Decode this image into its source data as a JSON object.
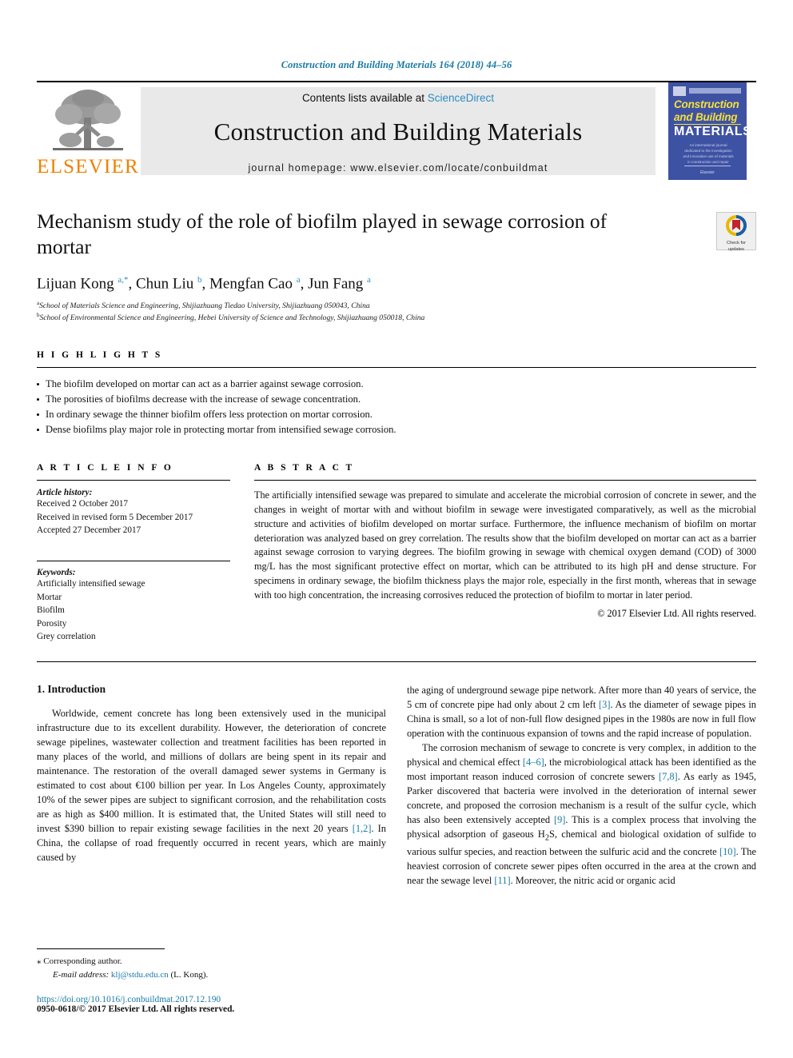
{
  "running_head": "Construction and Building Materials 164 (2018) 44–56",
  "masthead": {
    "publisher_name": "ELSEVIER",
    "contents_prefix": "Contents lists available at ",
    "contents_link": "ScienceDirect",
    "journal_title": "Construction and Building Materials",
    "homepage": "journal homepage: www.elsevier.com/locate/conbuildmat",
    "cover": {
      "line1": "Construction",
      "line2": "and Building",
      "line3": "MATERIALS",
      "blurb": "An international journal dedicated to the investigation and innovative use of materials in construction and repair",
      "footer": "Elsevier"
    }
  },
  "article": {
    "title": "Mechanism study of the role of biofilm played in sewage corrosion of mortar",
    "crossmark_line1": "Check for",
    "crossmark_line2": "updates",
    "authors_html": "Lijuan Kong <sup>a,*</sup>, Chun Liu <sup>b</sup>, Mengfan Cao <sup>a</sup>, Jun Fang <sup>a</sup>",
    "affiliations": [
      {
        "marker": "a",
        "text": "School of Materials Science and Engineering, Shijiazhuang Tiedao University, Shijiazhuang 050043, China"
      },
      {
        "marker": "b",
        "text": "School of Environmental Science and Engineering, Hebei University of Science and Technology, Shijiazhuang 050018, China"
      }
    ]
  },
  "highlights": {
    "label": "H I G H L I G H T S",
    "items": [
      "The biofilm developed on mortar can act as a barrier against sewage corrosion.",
      "The porosities of biofilms decrease with the increase of sewage concentration.",
      "In ordinary sewage the thinner biofilm offers less protection on mortar corrosion.",
      "Dense biofilms play major role in protecting mortar from intensified sewage corrosion."
    ]
  },
  "article_info": {
    "label": "A R T I C L E   I N F O",
    "history_head": "Article history:",
    "history": [
      "Received 2 October 2017",
      "Received in revised form 5 December 2017",
      "Accepted 27 December 2017"
    ],
    "keywords_head": "Keywords:",
    "keywords": [
      "Artificially intensified sewage",
      "Mortar",
      "Biofilm",
      "Porosity",
      "Grey correlation"
    ]
  },
  "abstract": {
    "label": "A B S T R A C T",
    "text": "The artificially intensified sewage was prepared to simulate and accelerate the microbial corrosion of concrete in sewer, and the changes in weight of mortar with and without biofilm in sewage were investigated comparatively, as well as the microbial structure and activities of biofilm developed on mortar surface. Furthermore, the influence mechanism of biofilm on mortar deterioration was analyzed based on grey correlation. The results show that the biofilm developed on mortar can act as a barrier against sewage corrosion to varying degrees. The biofilm growing in sewage with chemical oxygen demand (COD) of 3000 mg/L has the most significant protective effect on mortar, which can be attributed to its high pH and dense structure. For specimens in ordinary sewage, the biofilm thickness plays the major role, especially in the first month, whereas that in sewage with too high concentration, the increasing corrosives reduced the protection of biofilm to mortar in later period.",
    "copyright": "© 2017 Elsevier Ltd. All rights reserved."
  },
  "body": {
    "section_title": "1. Introduction",
    "left_paragraphs": [
      "Worldwide, cement concrete has long been extensively used in the municipal infrastructure due to its excellent durability. However, the deterioration of concrete sewage pipelines, wastewater collection and treatment facilities has been reported in many places of the world, and millions of dollars are being spent in its repair and maintenance. The restoration of the overall damaged sewer systems in Germany is estimated to cost about €100 billion per year. In Los Angeles County, approximately 10% of the sewer pipes are subject to significant corrosion, and the rehabilitation costs are as high as $400 million. It is estimated that, the United States will still need to invest $390 billion to repair existing sewage facilities in the next 20 years [1,2]. In China, the collapse of road frequently occurred in recent years, which are mainly caused by"
    ],
    "right_paragraphs": [
      "the aging of underground sewage pipe network. After more than 40 years of service, the 5 cm of concrete pipe had only about 2 cm left [3]. As the diameter of sewage pipes in China is small, so a lot of non-full flow designed pipes in the 1980s are now in full flow operation with the continuous expansion of towns and the rapid increase of population.",
      "The corrosion mechanism of sewage to concrete is very complex, in addition to the physical and chemical effect [4–6], the microbiological attack has been identified as the most important reason induced corrosion of concrete sewers [7,8]. As early as 1945, Parker discovered that bacteria were involved in the deterioration of internal sewer concrete, and proposed the corrosion mechanism is a result of the sulfur cycle, which has also been extensively accepted [9]. This is a complex process that involving the physical adsorption of gaseous H2S, chemical and biological oxidation of sulfide to various sulfur species, and reaction between the sulfuric acid and the concrete [10]. The heaviest corrosion of concrete sewer pipes often occurred in the area at the crown and near the sewage level [11]. Moreover, the nitric acid or organic acid"
    ]
  },
  "footnote": {
    "corresponding_marker": "⁎",
    "corresponding_text": "Corresponding author.",
    "email_label": "E-mail address:",
    "email": "klj@stdu.edu.cn",
    "email_suffix": "(L. Kong).",
    "doi": "https://doi.org/10.1016/j.conbuildmat.2017.12.190",
    "issn": "0950-0618/© 2017 Elsevier Ltd. All rights reserved."
  },
  "colors": {
    "link": "#1a7aa8",
    "sciencedirect": "#2b8dc4",
    "elsevier_orange": "#f08000",
    "cover_blue": "#3e52a4",
    "cover_yellow": "#f4e03a"
  }
}
